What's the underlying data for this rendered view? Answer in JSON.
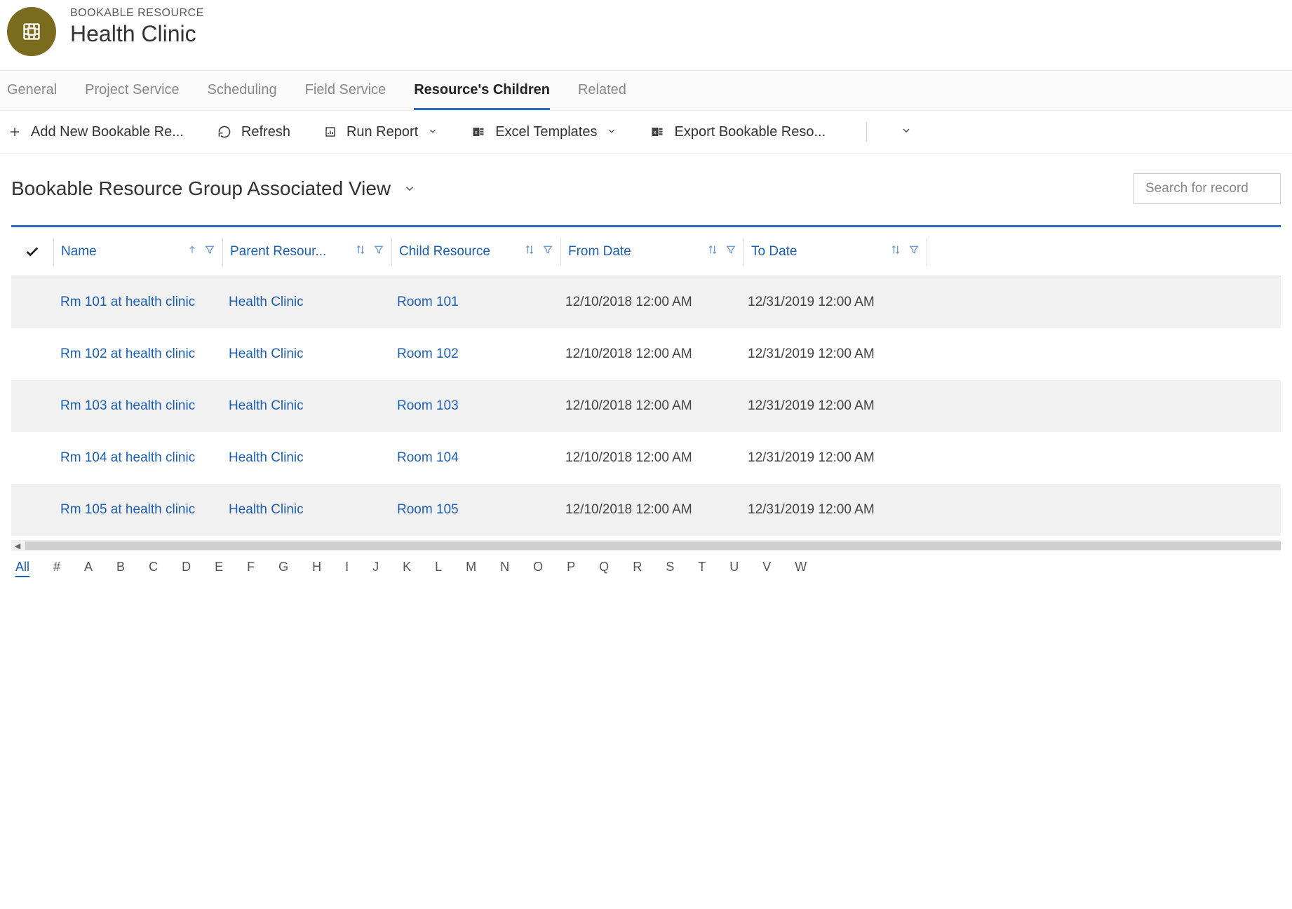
{
  "header": {
    "subtitle": "BOOKABLE RESOURCE",
    "title": "Health Clinic"
  },
  "tabs": [
    {
      "label": "General",
      "active": false
    },
    {
      "label": "Project Service",
      "active": false
    },
    {
      "label": "Scheduling",
      "active": false
    },
    {
      "label": "Field Service",
      "active": false
    },
    {
      "label": "Resource's Children",
      "active": true
    },
    {
      "label": "Related",
      "active": false
    }
  ],
  "toolbar": {
    "add_new": "Add New Bookable Re...",
    "refresh": "Refresh",
    "run_report": "Run Report",
    "excel_templates": "Excel Templates",
    "export": "Export Bookable Reso..."
  },
  "view": {
    "title": "Bookable Resource Group Associated View",
    "search_placeholder": "Search for record"
  },
  "columns": {
    "name": "Name",
    "parent": "Parent Resour...",
    "child": "Child Resource",
    "from": "From Date",
    "to": "To Date"
  },
  "rows": [
    {
      "name": "Rm 101 at health clinic",
      "parent": "Health Clinic",
      "child": "Room 101",
      "from": "12/10/2018 12:00 AM",
      "to": "12/31/2019 12:00 AM"
    },
    {
      "name": "Rm 102 at health clinic",
      "parent": "Health Clinic",
      "child": "Room 102",
      "from": "12/10/2018 12:00 AM",
      "to": "12/31/2019 12:00 AM"
    },
    {
      "name": "Rm 103 at health clinic",
      "parent": "Health Clinic",
      "child": "Room 103",
      "from": "12/10/2018 12:00 AM",
      "to": "12/31/2019 12:00 AM"
    },
    {
      "name": "Rm 104 at health clinic",
      "parent": "Health Clinic",
      "child": "Room 104",
      "from": "12/10/2018 12:00 AM",
      "to": "12/31/2019 12:00 AM"
    },
    {
      "name": "Rm 105 at health clinic",
      "parent": "Health Clinic",
      "child": "Room 105",
      "from": "12/10/2018 12:00 AM",
      "to": "12/31/2019 12:00 AM"
    }
  ],
  "alpha": [
    "All",
    "#",
    "A",
    "B",
    "C",
    "D",
    "E",
    "F",
    "G",
    "H",
    "I",
    "J",
    "K",
    "L",
    "M",
    "N",
    "O",
    "P",
    "Q",
    "R",
    "S",
    "T",
    "U",
    "V",
    "W"
  ],
  "alpha_active": "All"
}
